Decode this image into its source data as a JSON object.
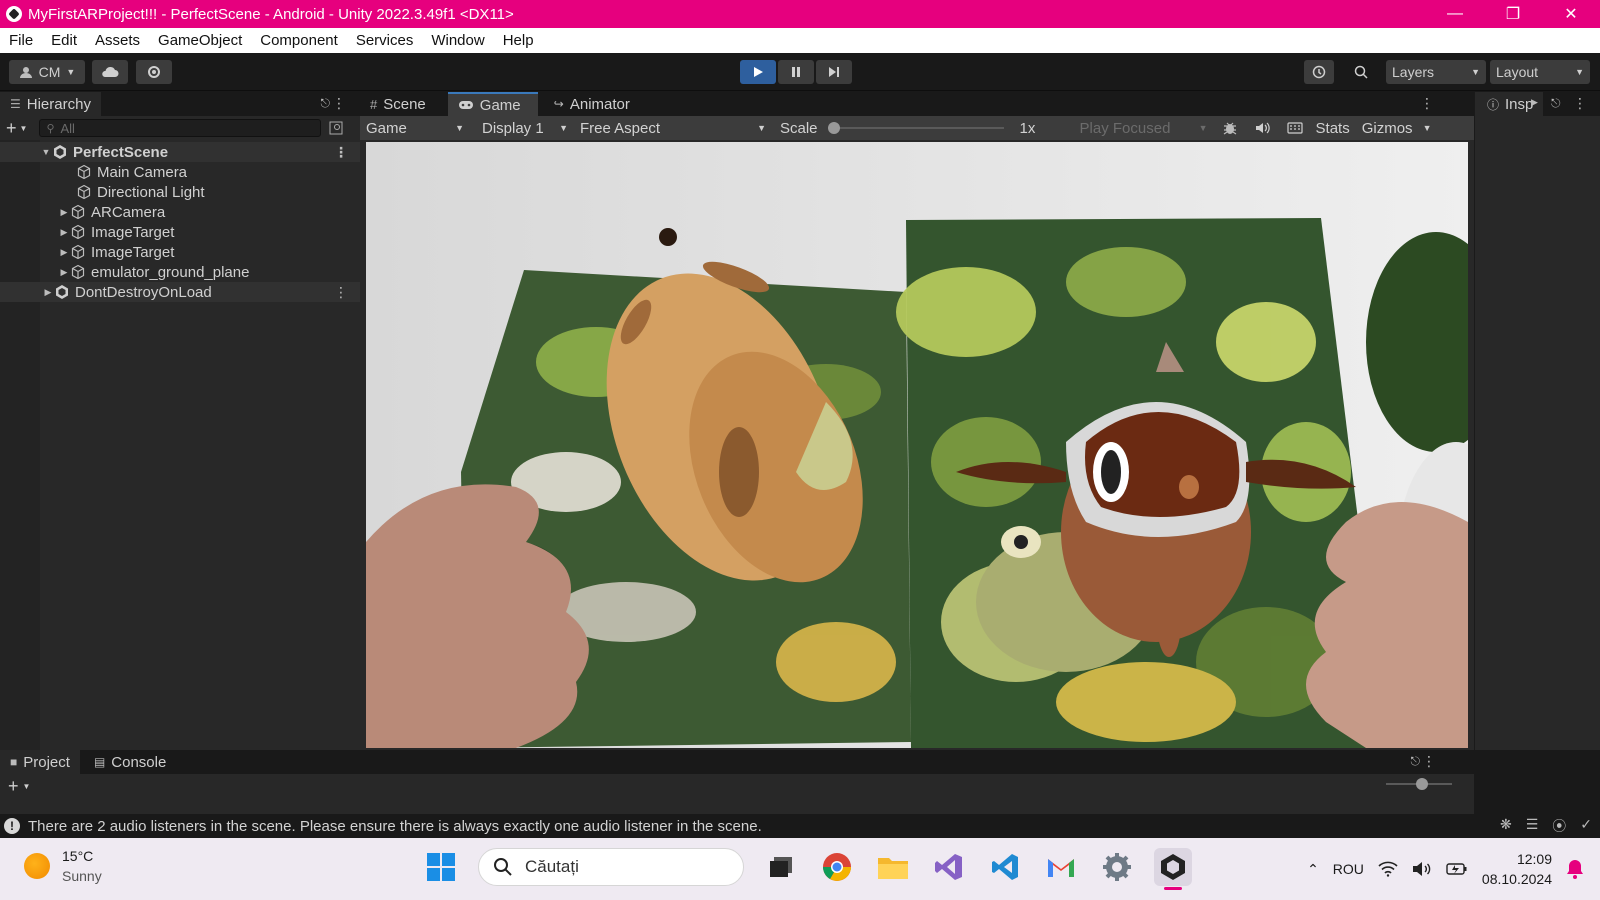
{
  "window": {
    "title": "MyFirstARProject!!! - PerfectScene - Android - Unity 2022.3.49f1 <DX11>",
    "accent_color": "#e6007e"
  },
  "menubar": [
    "File",
    "Edit",
    "Assets",
    "GameObject",
    "Component",
    "Services",
    "Window",
    "Help"
  ],
  "toolbar": {
    "account": "CM",
    "layers": "Layers",
    "layout": "Layout"
  },
  "hierarchy": {
    "tab": "Hierarchy",
    "search_placeholder": "All",
    "scene": "PerfectScene",
    "items": [
      "Main Camera",
      "Directional Light",
      "ARCamera",
      "ImageTarget",
      "ImageTarget",
      "emulator_ground_plane"
    ],
    "dont_destroy": "DontDestroyOnLoad"
  },
  "view_tabs": [
    "Scene",
    "Game",
    "Animator"
  ],
  "game_toolbar": {
    "mode": "Game",
    "display": "Display 1",
    "aspect": "Free Aspect",
    "scale_label": "Scale",
    "scale_value": "1x",
    "play_focused": "Play Focused",
    "stats": "Stats",
    "gizmos": "Gizmos"
  },
  "inspector": {
    "tab": "Insp"
  },
  "bottom_tabs": [
    "Project",
    "Console"
  ],
  "status": {
    "message": "There are 2 audio listeners in the scene. Please ensure there is always exactly one audio listener in the scene."
  },
  "taskbar": {
    "temperature": "15°C",
    "weather": "Sunny",
    "search_placeholder": "Căutați",
    "language": "ROU",
    "time": "12:09",
    "date": "08.10.2024"
  }
}
